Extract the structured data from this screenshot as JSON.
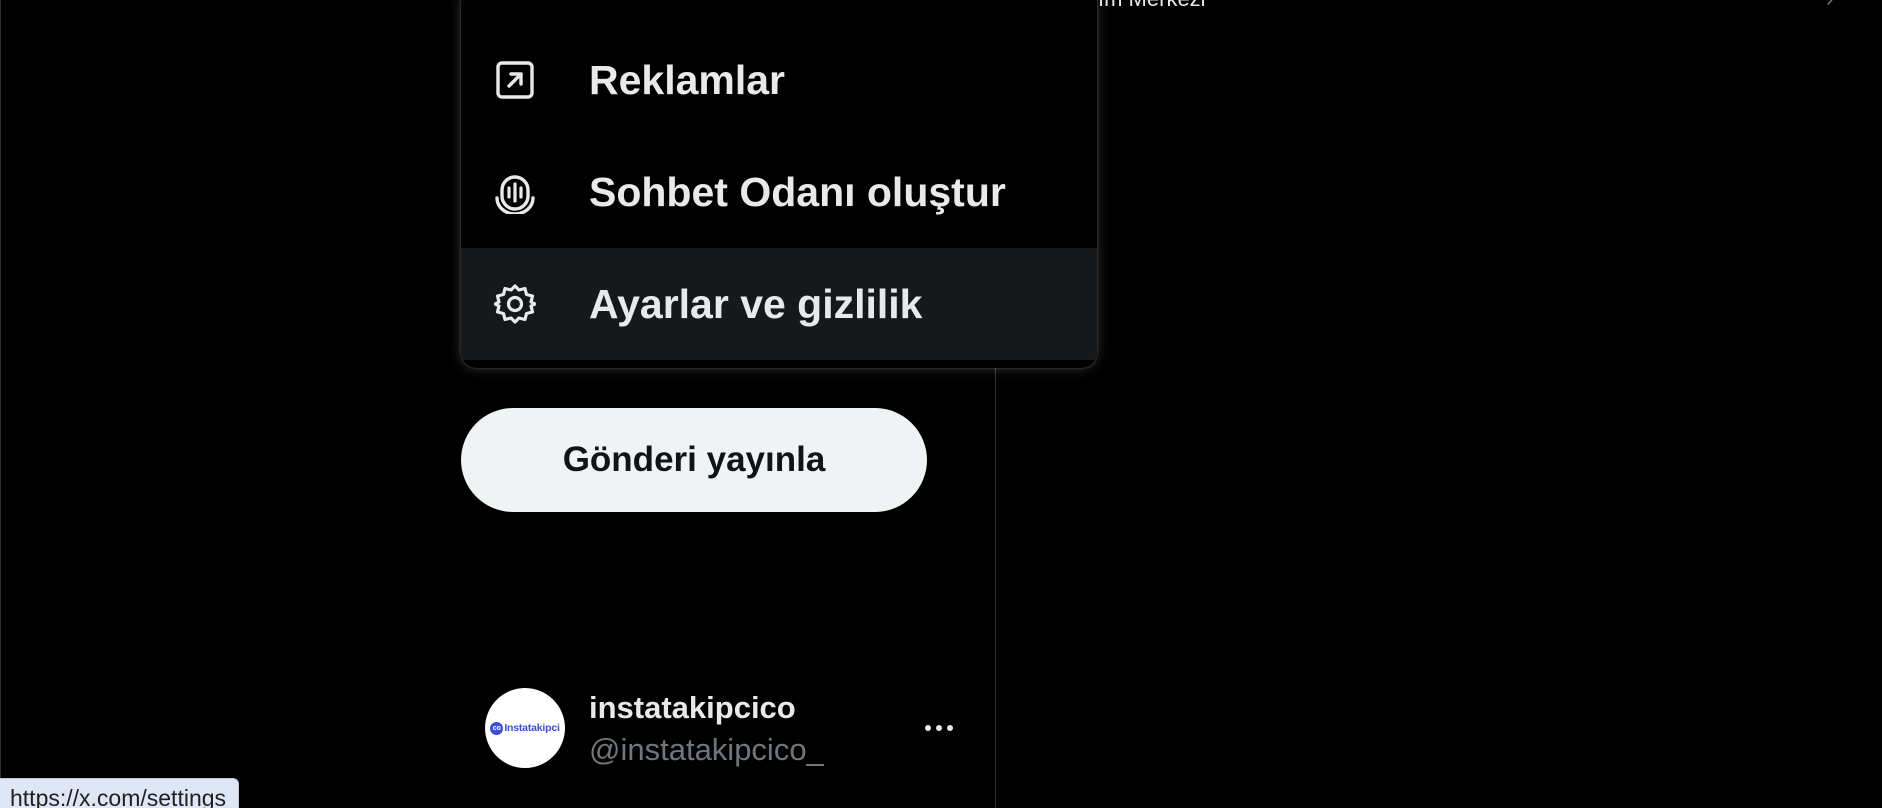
{
  "background": {
    "top_right_text": "ım Merkezi",
    "top_right_chevron": "›"
  },
  "menu": {
    "items": [
      {
        "label": "Reklamlar",
        "icon": "external-link-icon"
      },
      {
        "label": "Sohbet Odanı oluştur",
        "icon": "microphone-spaces-icon"
      },
      {
        "label": "Ayarlar ve gizlilik",
        "icon": "gear-icon",
        "hovered": true
      }
    ]
  },
  "sidebar": {
    "post_button_label": "Gönderi yayınla"
  },
  "account": {
    "display_name": "instatakipcico",
    "handle": "@instatakipcico_",
    "avatar_logo_text": "Instatakipci",
    "avatar_logo_mark": "co",
    "more_icon": "more-horizontal-icon"
  },
  "status_bar": {
    "url": "https://x.com/settings"
  },
  "colors": {
    "background": "#000000",
    "text": "#e7e9ea",
    "muted": "#71767b",
    "hover": "#16181c",
    "post_button_bg": "#eff3f4",
    "avatar_brand": "#3a4fd6"
  }
}
